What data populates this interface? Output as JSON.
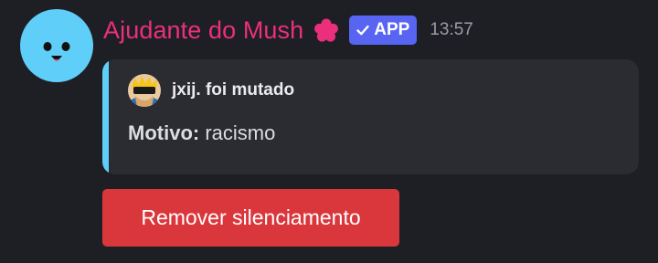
{
  "message": {
    "username": "Ajudante do Mush",
    "badge_label": "APP",
    "timestamp": "13:57",
    "author_avatar_icon": "smiley-face-icon",
    "role_icon": "pink-flower-icon",
    "badge_icon": "check-icon"
  },
  "embed": {
    "author_name": "jxij. foi mutado",
    "author_avatar_icon": "user-avatar-icon",
    "field_name": "Motivo:",
    "field_value": "racismo",
    "accent_color": "#5fcff9"
  },
  "actions": {
    "unmute_label": "Remover silenciamento"
  },
  "colors": {
    "background": "#1e1f24",
    "username": "#ec2f7c",
    "badge": "#5865f2",
    "button": "#da373c",
    "embed_background": "#2b2c32"
  }
}
